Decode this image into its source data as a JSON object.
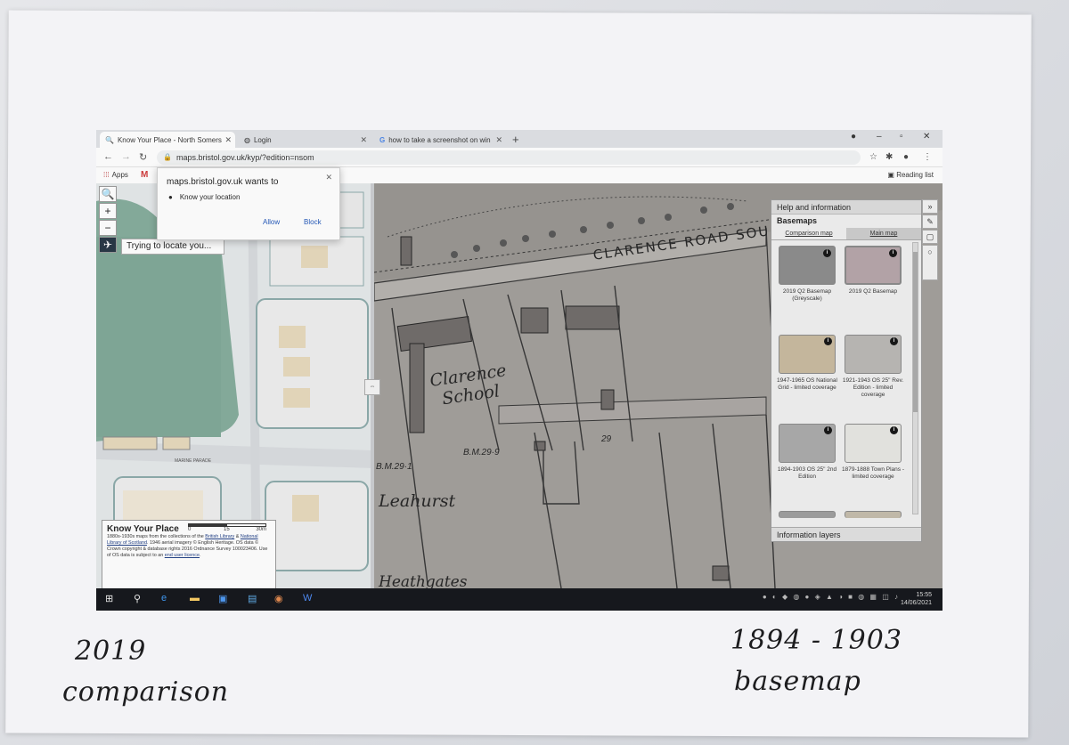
{
  "browser": {
    "tabs": [
      {
        "label": "Know Your Place - North Somers",
        "active": true
      },
      {
        "label": "Login",
        "active": false
      },
      {
        "label": "how to take a screenshot on win",
        "active": false
      }
    ],
    "url": "maps.bristol.gov.uk/kyp/?edition=nsom",
    "bookmarks": {
      "apps": "Apps",
      "reading_list": "Reading list"
    }
  },
  "permission_prompt": {
    "title": "maps.bristol.gov.uk wants to",
    "request": "Know your location",
    "allow": "Allow",
    "block": "Block"
  },
  "map": {
    "locating_text": "Trying to locate you...",
    "left_labels": {
      "street": "MARINE PARADE"
    },
    "right_labels": {
      "road": "CLARENCE ROAD SOU",
      "school": "Clarence School",
      "house1": "Leahurst",
      "house2": "Heathgates",
      "bm1": "B.M.29·9",
      "bm2": "B.M.29·1",
      "num": "29"
    }
  },
  "kyp_box": {
    "title": "Know Your Place",
    "scale": [
      "0",
      "15",
      "30m"
    ],
    "attribution_pre": "1880s-1930s maps from the collections of the ",
    "link1": "British Library",
    "and": " & ",
    "link2": "National Library of Scotland",
    "attribution_mid": ". 1946 aerial imagery © English Heritage. OS data © Crown copyright & database rights 2016 Ordnance Survey 100023406. Use of OS data is subject to an ",
    "link3": "end user licence",
    "attribution_end": "."
  },
  "panel": {
    "header": "Help and information",
    "section": "Basemaps",
    "tab_comparison": "Comparison map",
    "tab_main": "Main map",
    "tiles": [
      {
        "label": "2019 Q2 Basemap (Greyscale)",
        "color": "#8b8b8b"
      },
      {
        "label": "2019 Q2 Basemap",
        "color": "#b6a3a8"
      },
      {
        "label": "1947-1965 OS National Grid - limited coverage",
        "color": "#c9b99a"
      },
      {
        "label": "1921-1943 OS 25\" Rev. Edition - limited coverage",
        "color": "#b9b7b3"
      },
      {
        "label": "1894-1903 OS 25\" 2nd Edition",
        "color": "#a9a9a9"
      },
      {
        "label": "1879-1888 Town Plans - limited coverage",
        "color": "#e6e6e2"
      }
    ],
    "footer": "Information layers"
  },
  "taskbar": {
    "time": "15:55",
    "date": "14/06/2021"
  },
  "captions": {
    "left_line1": "2019",
    "left_line2": "comparison",
    "right_line1": "1894 - 1903",
    "right_line2": "basemap"
  }
}
